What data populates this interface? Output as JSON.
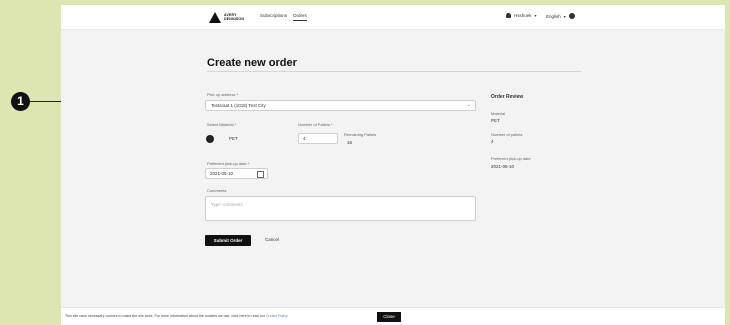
{
  "annotation": {
    "marker": "1"
  },
  "topbar": {
    "logo_text": "AVERY DENNISON",
    "nav": [
      "Subscriptions",
      "Orders"
    ],
    "user": "Hsshoek",
    "language": "English"
  },
  "form": {
    "title": "Create new order",
    "pickup_label": "Pick up address *",
    "pickup_value": "Testsraat 1 (1018) Test City",
    "material_label": "Select Material *",
    "material_value": "PET",
    "pallets_label": "Number of Pallets *",
    "pallets_value": "4",
    "remaining_label": "Remaining Pallets",
    "remaining_value": "16",
    "date_label": "Preferred pick-up date *",
    "date_value": "2021-05-10",
    "comments_label": "Comments",
    "comments_placeholder": "Type comments",
    "submit_label": "Submit Order",
    "cancel_label": "Cancel"
  },
  "review": {
    "title": "Order Review",
    "material_key": "Material",
    "material_value": "PET",
    "pallets_key": "Number of pallets",
    "pallets_value": "4",
    "date_key": "Preferred pick-up date",
    "date_value": "2021-05-10"
  },
  "cookie": {
    "text": "This site uses necessary cookies to make the site work. For more information about the cookies we use, click here to read our",
    "link": "Cookie Policy",
    "close_label": "Close"
  }
}
